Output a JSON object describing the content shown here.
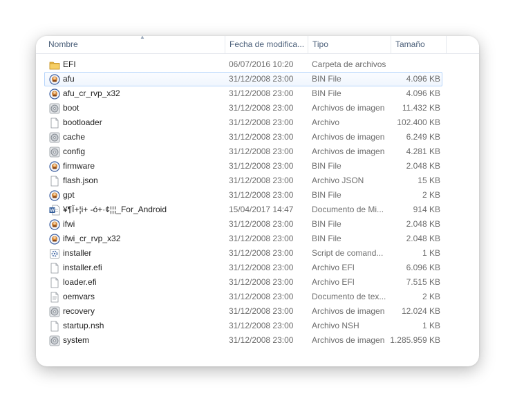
{
  "columns": {
    "name": "Nombre",
    "date": "Fecha de modifica...",
    "type": "Tipo",
    "size": "Tamaño"
  },
  "sort_icon": "chevron-up-icon",
  "files": [
    {
      "name": "EFI",
      "date": "06/07/2016 10:20",
      "type": "Carpeta de archivos",
      "size": "",
      "icon": "folder-icon"
    },
    {
      "name": "afu",
      "date": "31/12/2008 23:00",
      "type": "BIN File",
      "size": "4.096 KB",
      "icon": "bin-file-icon"
    },
    {
      "name": "afu_cr_rvp_x32",
      "date": "31/12/2008 23:00",
      "type": "BIN File",
      "size": "4.096 KB",
      "icon": "bin-file-icon"
    },
    {
      "name": "boot",
      "date": "31/12/2008 23:00",
      "type": "Archivos de imagen",
      "size": "11.432 KB",
      "icon": "disc-image-icon"
    },
    {
      "name": "bootloader",
      "date": "31/12/2008 23:00",
      "type": "Archivo",
      "size": "102.400 KB",
      "icon": "generic-file-icon"
    },
    {
      "name": "cache",
      "date": "31/12/2008 23:00",
      "type": "Archivos de imagen",
      "size": "6.249 KB",
      "icon": "disc-image-icon"
    },
    {
      "name": "config",
      "date": "31/12/2008 23:00",
      "type": "Archivos de imagen",
      "size": "4.281 KB",
      "icon": "disc-image-icon"
    },
    {
      "name": "firmware",
      "date": "31/12/2008 23:00",
      "type": "BIN File",
      "size": "2.048 KB",
      "icon": "bin-file-icon"
    },
    {
      "name": "flash.json",
      "date": "31/12/2008 23:00",
      "type": "Archivo JSON",
      "size": "15 KB",
      "icon": "generic-file-icon"
    },
    {
      "name": "gpt",
      "date": "31/12/2008 23:00",
      "type": "BIN File",
      "size": "2 KB",
      "icon": "bin-file-icon"
    },
    {
      "name": "¥¶Ï+¦i+ -ó+·¢¦¦¦_For_Android",
      "date": "15/04/2017 14:47",
      "type": "Documento de Mi...",
      "size": "914 KB",
      "icon": "word-document-icon"
    },
    {
      "name": "ifwi",
      "date": "31/12/2008 23:00",
      "type": "BIN File",
      "size": "2.048 KB",
      "icon": "bin-file-icon"
    },
    {
      "name": "ifwi_cr_rvp_x32",
      "date": "31/12/2008 23:00",
      "type": "BIN File",
      "size": "2.048 KB",
      "icon": "bin-file-icon"
    },
    {
      "name": "installer",
      "date": "31/12/2008 23:00",
      "type": "Script de comand...",
      "size": "1 KB",
      "icon": "script-file-icon"
    },
    {
      "name": "installer.efi",
      "date": "31/12/2008 23:00",
      "type": "Archivo EFI",
      "size": "6.096 KB",
      "icon": "generic-file-icon"
    },
    {
      "name": "loader.efi",
      "date": "31/12/2008 23:00",
      "type": "Archivo EFI",
      "size": "7.515 KB",
      "icon": "generic-file-icon"
    },
    {
      "name": "oemvars",
      "date": "31/12/2008 23:00",
      "type": "Documento de tex...",
      "size": "2 KB",
      "icon": "text-file-icon"
    },
    {
      "name": "recovery",
      "date": "31/12/2008 23:00",
      "type": "Archivos de imagen",
      "size": "12.024 KB",
      "icon": "disc-image-icon"
    },
    {
      "name": "startup.nsh",
      "date": "31/12/2008 23:00",
      "type": "Archivo NSH",
      "size": "1 KB",
      "icon": "generic-file-icon"
    },
    {
      "name": "system",
      "date": "31/12/2008 23:00",
      "type": "Archivos de imagen",
      "size": "1.285.959 KB",
      "icon": "disc-image-icon"
    }
  ],
  "hover_row": 1,
  "colors": {
    "header_text": "#4c607a",
    "hover_border": "#b8d6fb",
    "row_text": "#6d6d6d"
  }
}
